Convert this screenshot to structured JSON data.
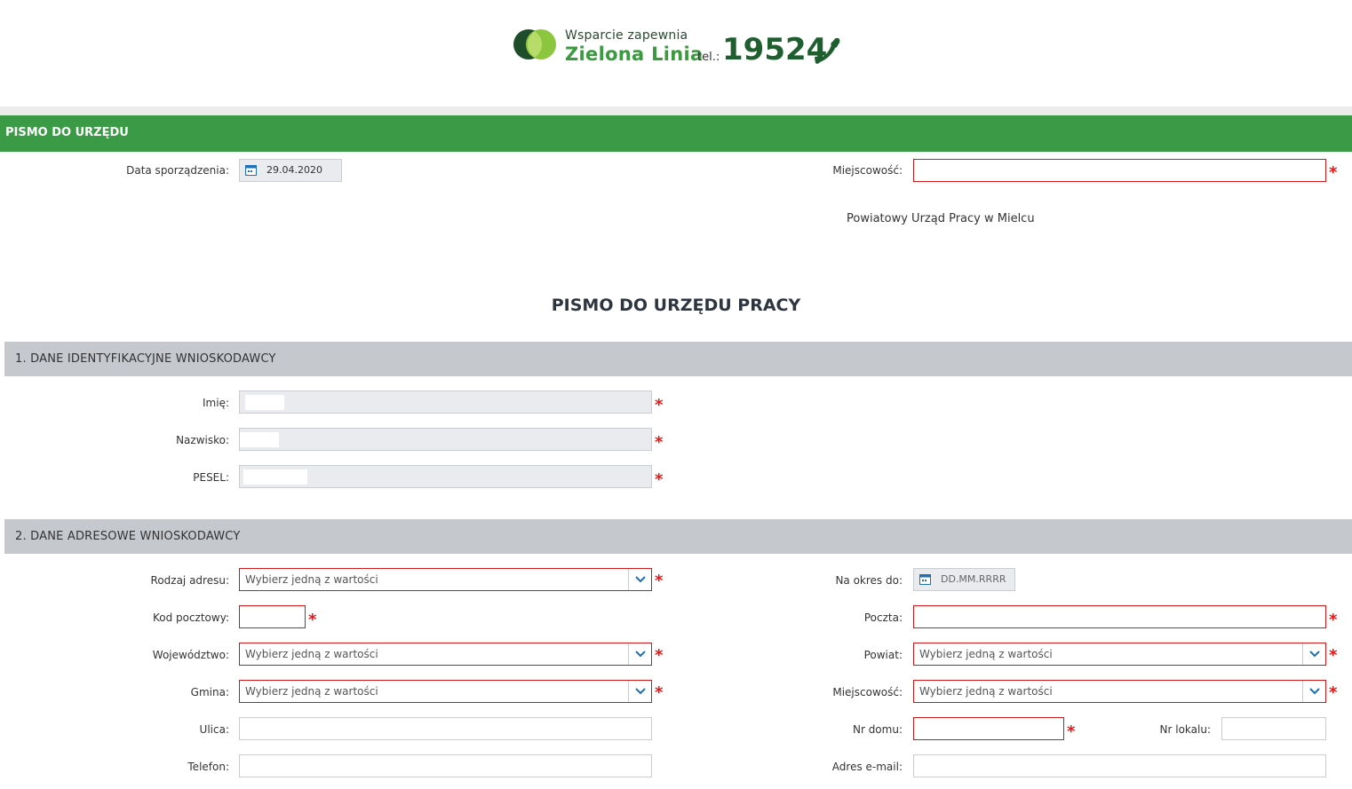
{
  "header": {
    "tagline": "Wsparcie zapewnia",
    "brand_name": "Zielona Linia",
    "tel_label": "tel.:",
    "tel_number": "19524"
  },
  "form_header": {
    "title": "PISMO DO URZĘDU",
    "date_label": "Data sporządzenia:",
    "date_value": "29.04.2020",
    "city_label": "Miejscowość:",
    "city_value": "",
    "office_name": "Powiatowy Urząd Pracy w Mielcu",
    "document_title": "PISMO DO URZĘDU PRACY"
  },
  "section1": {
    "title": "1. DANE IDENTYFIKACYJNE WNIOSKODAWCY",
    "first_name_label": "Imię:",
    "last_name_label": "Nazwisko:",
    "pesel_label": "PESEL:"
  },
  "section2": {
    "title": "2. DANE ADRESOWE WNIOSKODAWCY",
    "address_type_label": "Rodzaj adresu:",
    "address_type_value": "Wybierz jedną z wartości",
    "valid_until_label": "Na okres do:",
    "valid_until_placeholder": "DD.MM.RRRR",
    "postal_code_label": "Kod pocztowy:",
    "post_office_label": "Poczta:",
    "voivodeship_label": "Województwo:",
    "voivodeship_value": "Wybierz jedną z wartości",
    "county_label": "Powiat:",
    "county_value": "Wybierz jedną z wartości",
    "commune_label": "Gmina:",
    "commune_value": "Wybierz jedną z wartości",
    "locality_label": "Miejscowość:",
    "locality_value": "Wybierz jedną z wartości",
    "street_label": "Ulica:",
    "house_no_label": "Nr domu:",
    "apartment_no_label": "Nr lokalu:",
    "phone_label": "Telefon:",
    "email_label": "Adres e-mail:"
  },
  "required_mark": "*",
  "colors": {
    "brand_green": "#3a9a45",
    "dark_green": "#1f5e2f",
    "required_red": "#e01818",
    "section_grey": "#c5c9ce"
  }
}
